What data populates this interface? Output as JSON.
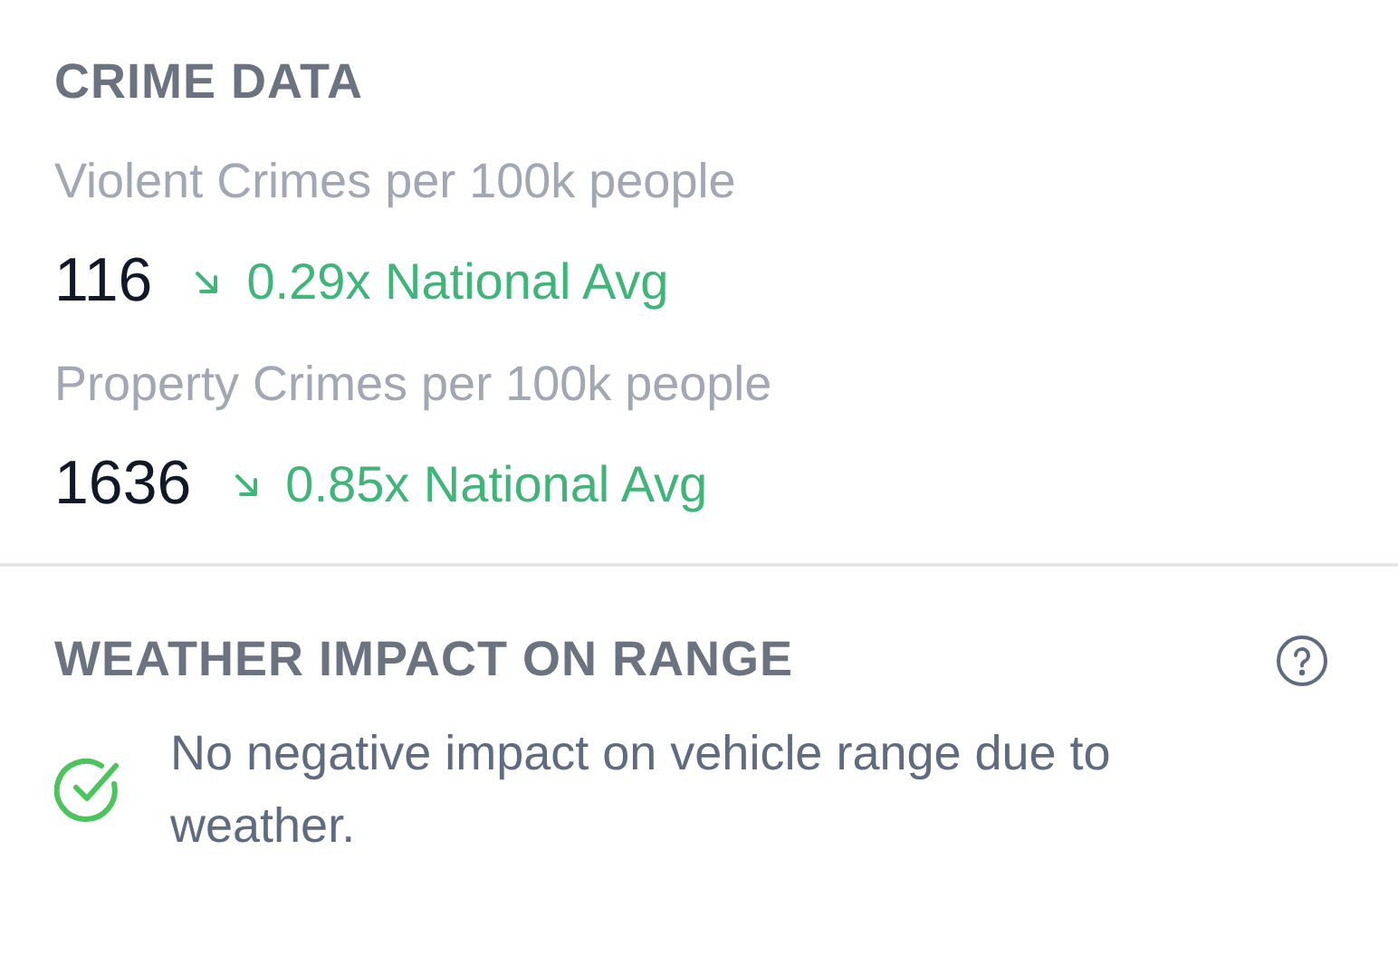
{
  "crime_data": {
    "title": "CRIME DATA",
    "metrics": [
      {
        "label": "Violent Crimes per 100k people",
        "value": "116",
        "kind": "down",
        "comparison": "0.29x National Avg"
      },
      {
        "label": "Property Crimes per 100k people",
        "value": "1636",
        "kind": "down",
        "comparison": "0.85x National Avg"
      }
    ]
  },
  "weather_impact": {
    "title": "WEATHER IMPACT ON RANGE",
    "kind": "ok",
    "message": "No negative impact on vehicle range due to weather."
  }
}
